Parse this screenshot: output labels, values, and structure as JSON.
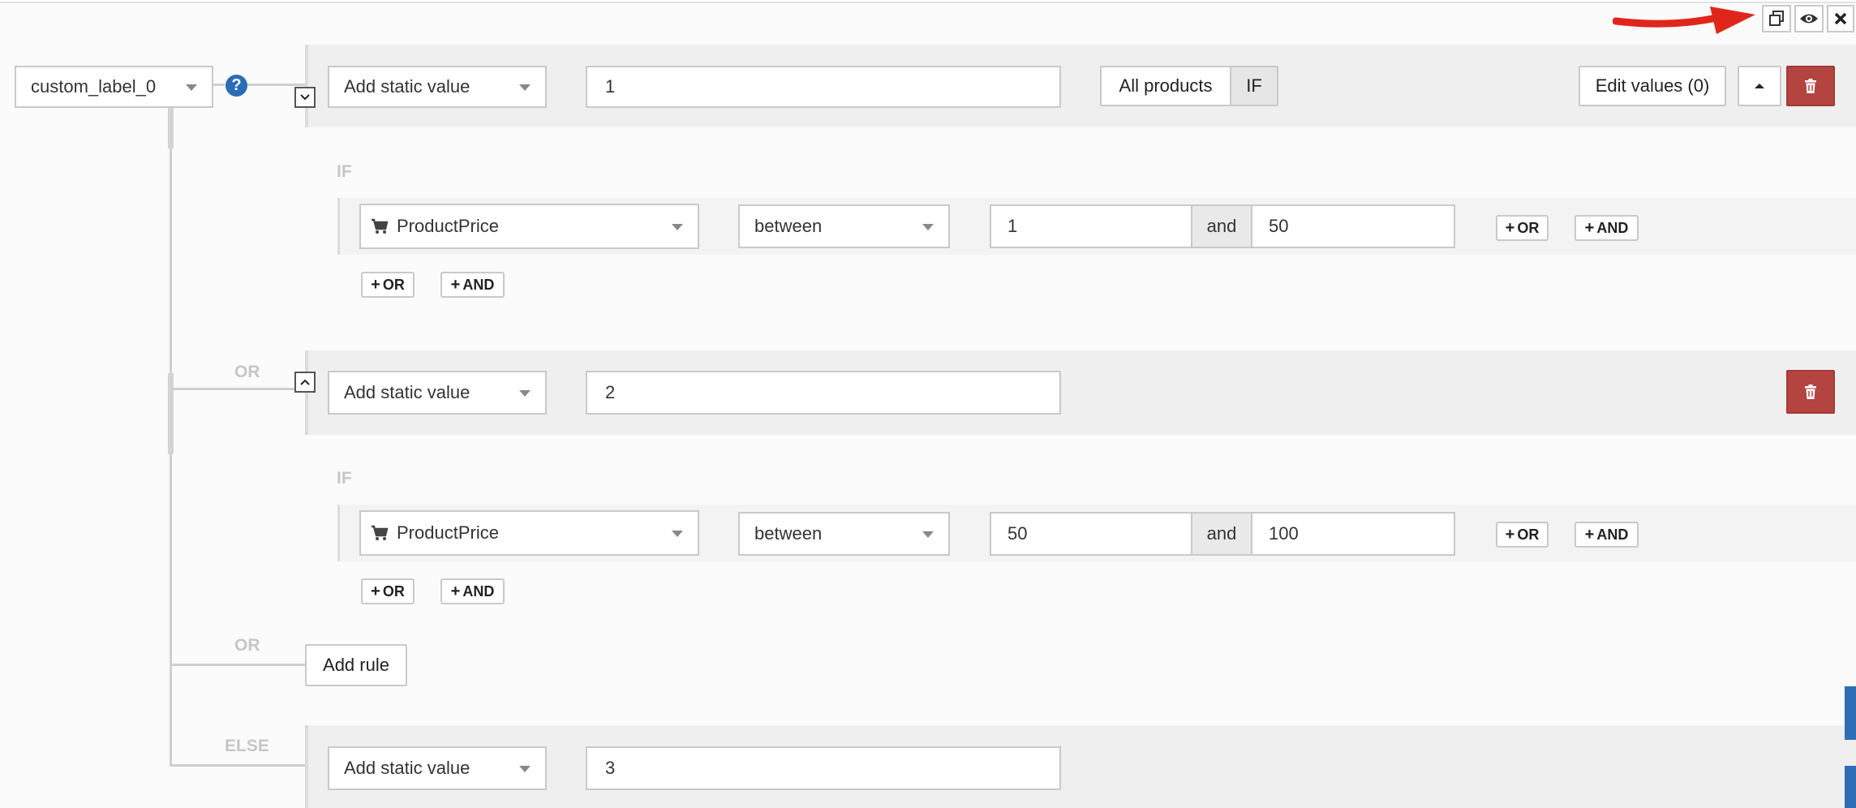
{
  "top_icons": {
    "copy": "copy-icon",
    "preview": "eye-icon",
    "close": "close-icon"
  },
  "field": {
    "value": "custom_label_0"
  },
  "help": {
    "glyph": "?"
  },
  "rules": [
    {
      "type_select": "Add static value",
      "value": "1",
      "scope_label": "All products",
      "if_label": "IF",
      "edit_values": "Edit values (0)",
      "condition_label": "IF",
      "condition": {
        "attribute": "ProductPrice",
        "operator": "between",
        "from": "1",
        "and_label": "and",
        "to": "50"
      }
    },
    {
      "connector": "OR",
      "type_select": "Add static value",
      "value": "2",
      "condition_label": "IF",
      "condition": {
        "attribute": "ProductPrice",
        "operator": "between",
        "from": "50",
        "and_label": "and",
        "to": "100"
      }
    }
  ],
  "or_button": "OR",
  "and_button": "AND",
  "add_rule": {
    "connector": "OR",
    "label": "Add rule"
  },
  "else_rule": {
    "connector": "ELSE",
    "type_select": "Add static value",
    "value": "3"
  },
  "colors": {
    "accent": "#2a6db5",
    "danger": "#b3443f",
    "arrow": "#e0261b"
  }
}
